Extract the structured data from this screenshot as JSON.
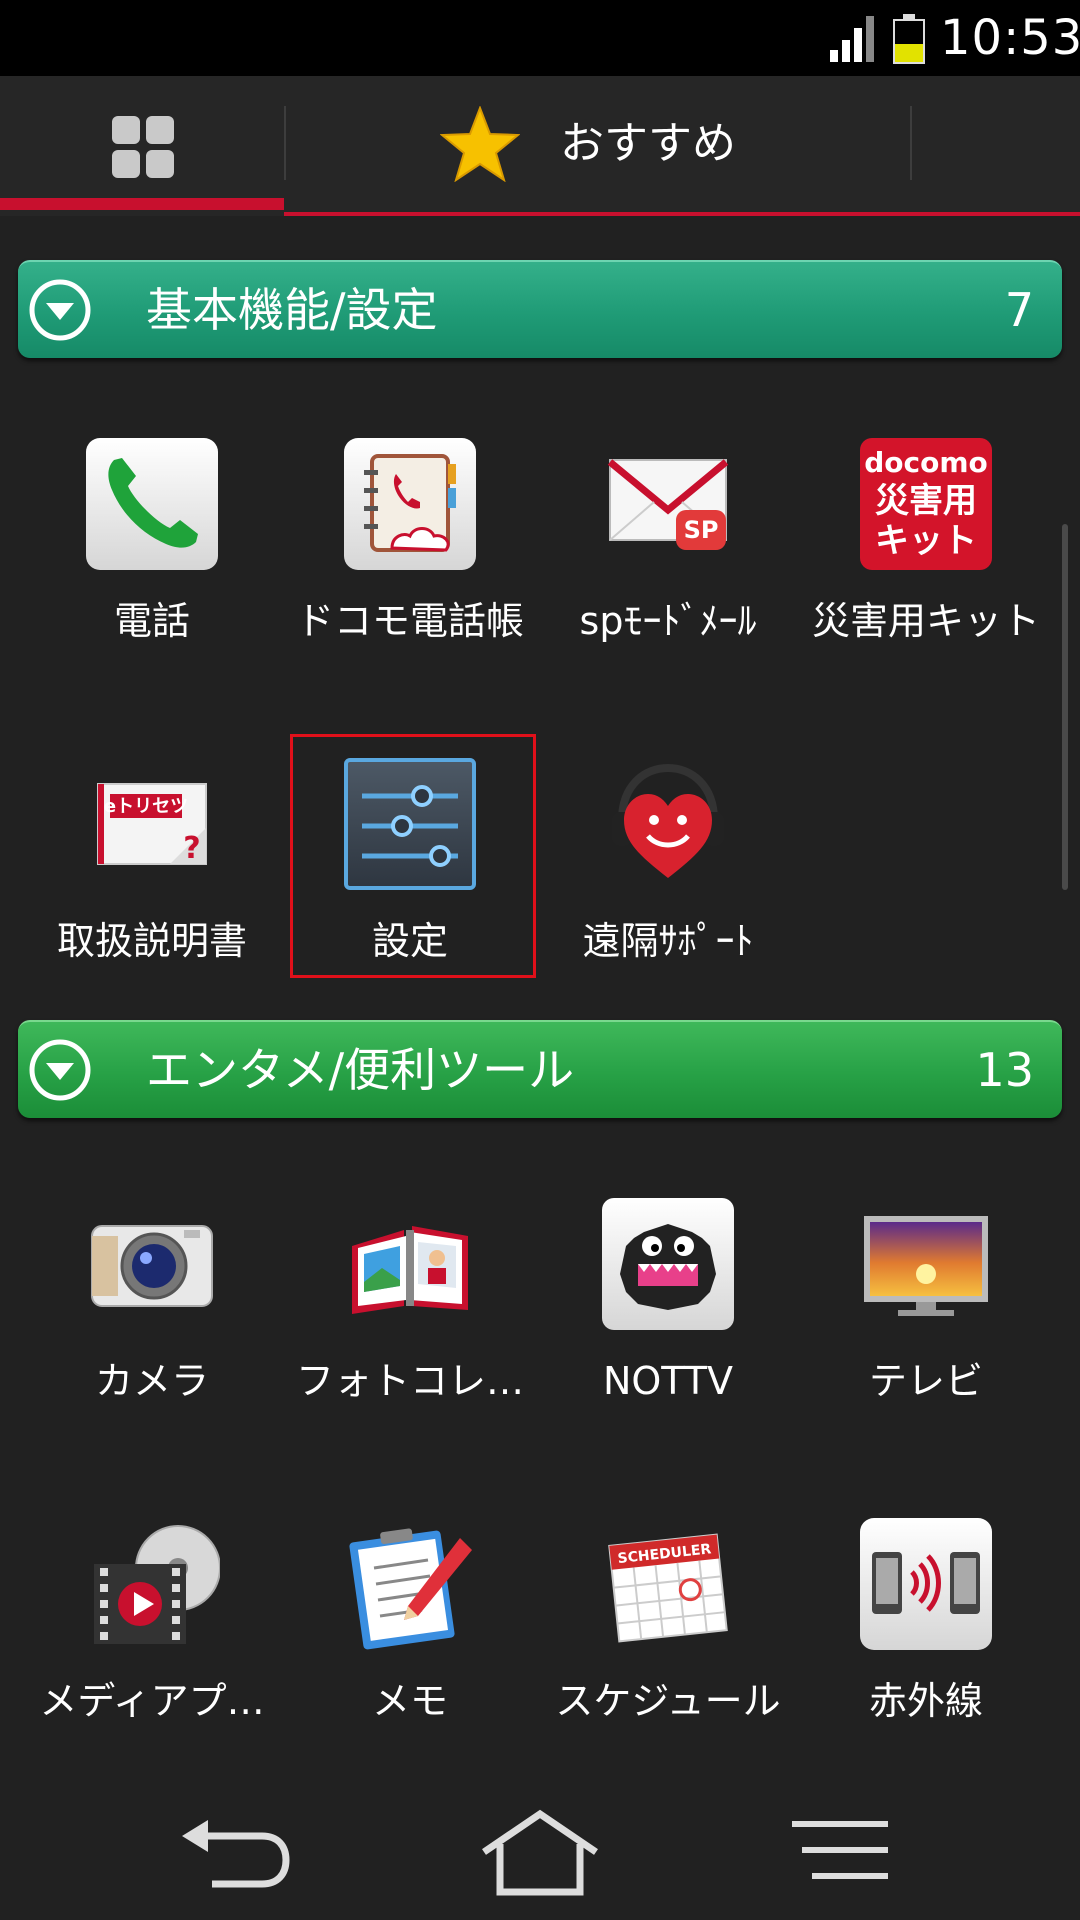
{
  "status_bar": {
    "time": "10:53"
  },
  "tabs": {
    "recommend_label": "おすすめ"
  },
  "sections": [
    {
      "title": "基本機能/設定",
      "count": "7"
    },
    {
      "title": "エンタメ/便利ツール",
      "count": "13"
    }
  ],
  "apps_basic": [
    {
      "label": "電話"
    },
    {
      "label": "ドコモ電話帳"
    },
    {
      "label": "spﾓｰﾄﾞﾒｰﾙ"
    },
    {
      "label": "災害用キット",
      "icon_text": [
        "docomo",
        "災害用",
        "キット"
      ]
    },
    {
      "label": "取扱説明書",
      "icon_text": "eトリセツ"
    },
    {
      "label": "設定"
    },
    {
      "label": "遠隔ｻﾎﾟｰﾄ"
    }
  ],
  "apps_enta": [
    {
      "label": "カメラ"
    },
    {
      "label": "フォトコレ…"
    },
    {
      "label": "NOTTV"
    },
    {
      "label": "テレビ"
    },
    {
      "label": "メディアプ…"
    },
    {
      "label": "メモ"
    },
    {
      "label": "スケジュール",
      "icon_text": "SCHEDULER"
    },
    {
      "label": "赤外線"
    }
  ],
  "colors": {
    "accent_red": "#c8102e",
    "section_teal": "#1f9b76",
    "section_green": "#27a146"
  }
}
